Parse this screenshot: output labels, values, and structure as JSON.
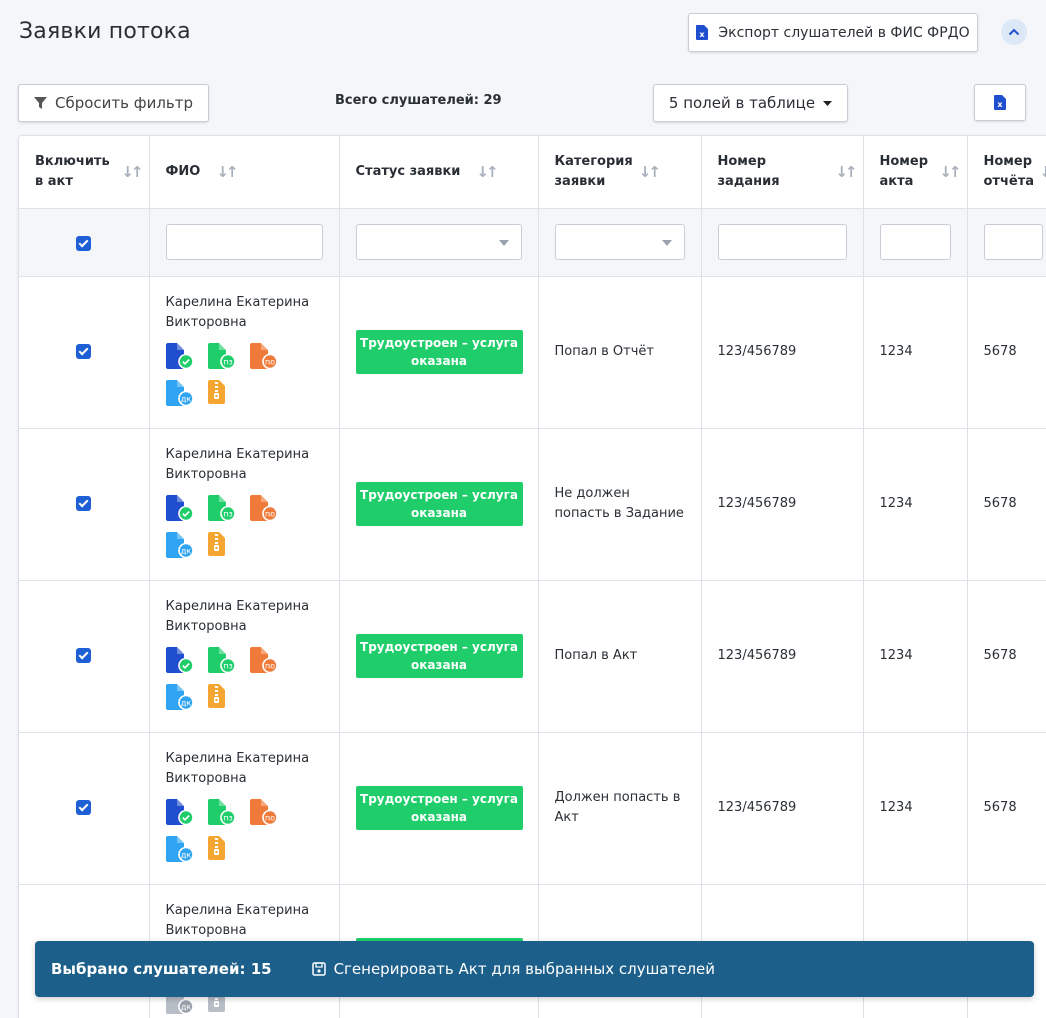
{
  "header": {
    "title": "Заявки потока",
    "export_label": "Экспорт слушателей в ФИС ФРДО"
  },
  "toolbar": {
    "reset_filter_label": "Сбросить фильтр",
    "total_listeners": "Всего слушателей: 29",
    "fields_label": "5 полей в таблице"
  },
  "table": {
    "columns": [
      "Включить в акт",
      "ФИО",
      "Статус заявки",
      "Категория заявки",
      "Номер задания",
      "Номер акта",
      "Номер отчёта"
    ],
    "rows": [
      {
        "included": true,
        "name": "Карелина Екатерина Викторовна",
        "status": "Трудоустроен – услуга оказана",
        "category": "Попал в Отчёт",
        "task_number": "123/456789",
        "act_number": "1234",
        "report_number": "5678"
      },
      {
        "included": true,
        "name": "Карелина Екатерина Викторовна",
        "status": "Трудоустроен – услуга оказана",
        "category": "Не должен попасть в Задание",
        "task_number": "123/456789",
        "act_number": "1234",
        "report_number": "5678"
      },
      {
        "included": true,
        "name": "Карелина Екатерина Викторовна",
        "status": "Трудоустроен – услуга оказана",
        "category": "Попал в Акт",
        "task_number": "123/456789",
        "act_number": "1234",
        "report_number": "5678"
      },
      {
        "included": true,
        "name": "Карелина Екатерина Викторовна",
        "status": "Трудоустроен – услуга оказана",
        "category": "Должен попасть в Акт",
        "task_number": "123/456789",
        "act_number": "1234",
        "report_number": "5678"
      },
      {
        "included": false,
        "name": "Карелина Екатерина Викторовна",
        "status": "Трудоустроен – услуга оказана",
        "category": "",
        "task_number": "",
        "act_number": "",
        "report_number": ""
      }
    ],
    "doc_icons": [
      {
        "name": "document-approved-icon",
        "label": "",
        "color": "#1f4fcf",
        "badge": "#1fce6a"
      },
      {
        "name": "document-pz-icon",
        "label": "пз",
        "color": "#1fce6a",
        "badge": "#1fce6a"
      },
      {
        "name": "document-po-icon",
        "label": "по",
        "color": "#f07a3a",
        "badge": "#f07a3a"
      },
      {
        "name": "document-dk-icon",
        "label": "дк",
        "color": "#2fa4f2",
        "badge": "#2fa4f2"
      },
      {
        "name": "archive-zip-icon",
        "label": "",
        "color": "#f5a532",
        "badge": ""
      }
    ]
  },
  "bottom_bar": {
    "selected": "Выбрано слушателей: 15",
    "generate_label": "Сгенерировать Акт для выбранных слушателей"
  },
  "colors": {
    "accent": "#1f5fd6",
    "status_green": "#1fce6a",
    "bottom_bar": "#1c5f8a"
  }
}
